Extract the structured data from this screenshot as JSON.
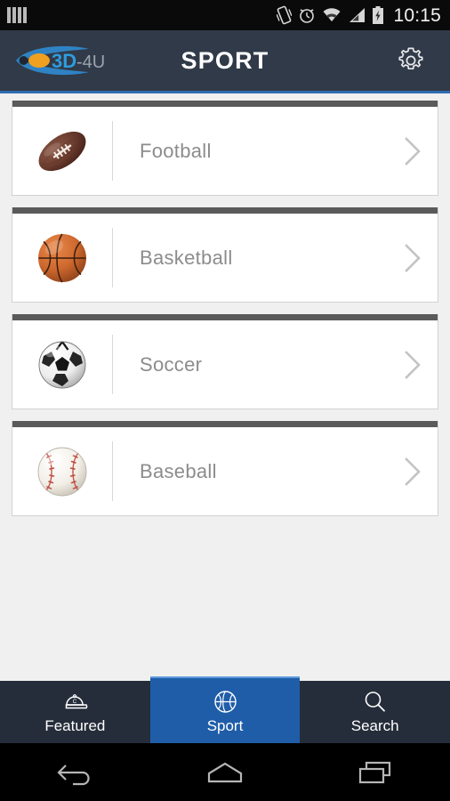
{
  "status_bar": {
    "time": "10:15",
    "left_icons": [
      "notification-bars-icon"
    ],
    "right_icons": [
      "vibrate-icon",
      "alarm-clock-icon",
      "wifi-icon",
      "cellular-signal-icon",
      "battery-charging-icon"
    ]
  },
  "header": {
    "logo_text_main": "3D",
    "logo_text_sub": "-4U",
    "title": "SPORT",
    "settings_icon": "gear-icon",
    "bg_color": "#313a48",
    "accent_color": "#2e6cb0"
  },
  "list": {
    "items": [
      {
        "label": "Football",
        "icon": "football-icon",
        "chevron": "chevron-right-icon"
      },
      {
        "label": "Basketball",
        "icon": "basketball-icon",
        "chevron": "chevron-right-icon"
      },
      {
        "label": "Soccer",
        "icon": "soccer-ball-icon",
        "chevron": "chevron-right-icon"
      },
      {
        "label": "Baseball",
        "icon": "baseball-icon",
        "chevron": "chevron-right-icon"
      }
    ]
  },
  "tab_bar": {
    "active_color": "#1f5da8",
    "tabs": [
      {
        "label": "Featured",
        "icon": "cap-icon",
        "active": false
      },
      {
        "label": "Sport",
        "icon": "basketball-icon",
        "active": true
      },
      {
        "label": "Search",
        "icon": "search-icon",
        "active": false
      }
    ]
  },
  "nav_bar": {
    "buttons": [
      {
        "name": "back-button",
        "icon": "back-arrow-icon"
      },
      {
        "name": "home-button",
        "icon": "home-icon"
      },
      {
        "name": "recents-button",
        "icon": "recents-icon"
      }
    ]
  }
}
